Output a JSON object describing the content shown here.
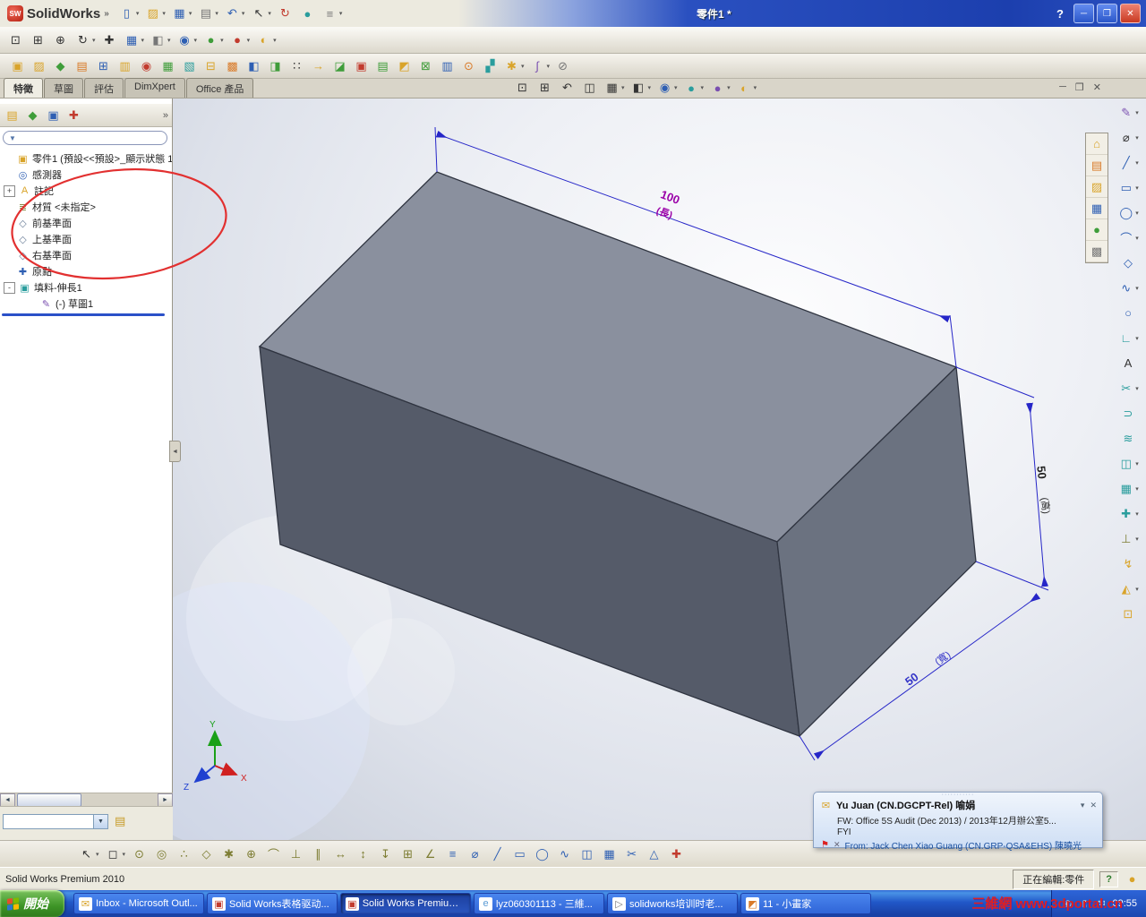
{
  "app": {
    "logo_text": "SolidWorks",
    "logo_chevron": "»",
    "title": "零件1 *",
    "help": "?",
    "min": "─",
    "restore": "❒",
    "close": "✕"
  },
  "toolbar_main": {
    "items": [
      {
        "name": "new-document-button",
        "glyph": "▯",
        "cls": "c-blue",
        "caret": true
      },
      {
        "name": "open-document-button",
        "glyph": "▨",
        "cls": "c-gold",
        "caret": true
      },
      {
        "name": "save-button",
        "glyph": "▦",
        "cls": "c-blue",
        "caret": true
      },
      {
        "name": "print-button",
        "glyph": "▤",
        "cls": "c-gray",
        "caret": true
      },
      {
        "name": "undo-button",
        "glyph": "↶",
        "cls": "c-blue",
        "caret": true
      },
      {
        "name": "select-button",
        "glyph": "↖",
        "cls": "c-dark",
        "caret": true
      },
      {
        "name": "rebuild-button",
        "glyph": "↻",
        "cls": "c-red"
      },
      {
        "name": "edit-color-button",
        "glyph": "●",
        "cls": "c-teal"
      },
      {
        "name": "options-button",
        "glyph": "≡",
        "cls": "c-gray",
        "caret": true
      }
    ]
  },
  "toolbar_view": {
    "items": [
      {
        "name": "zoom-to-fit-button",
        "glyph": "⊡",
        "cls": "c-dark"
      },
      {
        "name": "zoom-to-area-button",
        "glyph": "⊞",
        "cls": "c-dark"
      },
      {
        "name": "zoom-in-out-button",
        "glyph": "⊕",
        "cls": "c-dark"
      },
      {
        "name": "rotate-view-button",
        "glyph": "↻",
        "cls": "c-dark",
        "caret": true
      },
      {
        "name": "pan-view-button",
        "glyph": "✚",
        "cls": "c-dark"
      },
      {
        "name": "view-orientation-button",
        "glyph": "▦",
        "cls": "c-blue",
        "caret": true
      },
      {
        "name": "display-style-button",
        "glyph": "◧",
        "cls": "c-gray",
        "caret": true
      },
      {
        "name": "hide-show-items-button",
        "glyph": "◉",
        "cls": "c-blue",
        "caret": true
      },
      {
        "name": "edit-appearance-button",
        "glyph": "●",
        "cls": "c-green",
        "caret": true
      },
      {
        "name": "apply-scene-button",
        "glyph": "●",
        "cls": "c-red",
        "caret": true
      },
      {
        "name": "view-settings-button",
        "glyph": "◐",
        "cls": "c-gold",
        "caret": true
      }
    ]
  },
  "toolbar_custom": {
    "items": [
      {
        "name": "macro-tool-1",
        "glyph": "▣",
        "cls": "c-gold"
      },
      {
        "name": "macro-tool-2",
        "glyph": "▨",
        "cls": "c-gold"
      },
      {
        "name": "macro-tool-3",
        "glyph": "◆",
        "cls": "c-green"
      },
      {
        "name": "macro-tool-4",
        "glyph": "▤",
        "cls": "c-orange"
      },
      {
        "name": "macro-tool-5",
        "glyph": "⊞",
        "cls": "c-blue"
      },
      {
        "name": "macro-tool-6",
        "glyph": "▥",
        "cls": "c-gold"
      },
      {
        "name": "macro-tool-7",
        "glyph": "◉",
        "cls": "c-red"
      },
      {
        "name": "macro-tool-8",
        "glyph": "▦",
        "cls": "c-green"
      },
      {
        "name": "macro-tool-9",
        "glyph": "▧",
        "cls": "c-teal"
      },
      {
        "name": "macro-tool-10",
        "glyph": "⊟",
        "cls": "c-gold"
      },
      {
        "name": "macro-tool-11",
        "glyph": "▩",
        "cls": "c-orange"
      },
      {
        "name": "macro-tool-12",
        "glyph": "◧",
        "cls": "c-blue"
      },
      {
        "name": "macro-tool-13",
        "glyph": "◨",
        "cls": "c-green"
      },
      {
        "name": "macro-tool-14",
        "glyph": "∷",
        "cls": "c-dark"
      },
      {
        "name": "macro-tool-15",
        "glyph": "→",
        "cls": "c-gold"
      },
      {
        "name": "macro-tool-16",
        "glyph": "◪",
        "cls": "c-green"
      },
      {
        "name": "macro-tool-17",
        "glyph": "▣",
        "cls": "c-red"
      },
      {
        "name": "macro-tool-18",
        "glyph": "▤",
        "cls": "c-green"
      },
      {
        "name": "macro-tool-19",
        "glyph": "◩",
        "cls": "c-gold"
      },
      {
        "name": "macro-tool-20",
        "glyph": "⊠",
        "cls": "c-green"
      },
      {
        "name": "macro-tool-21",
        "glyph": "▥",
        "cls": "c-blue"
      },
      {
        "name": "macro-tool-22",
        "glyph": "⊙",
        "cls": "c-orange"
      },
      {
        "name": "macro-tool-23",
        "glyph": "▞",
        "cls": "c-teal"
      },
      {
        "name": "spellcheck-tool",
        "glyph": "✱",
        "cls": "c-gold",
        "caret": true
      },
      {
        "name": "curvature-tool",
        "glyph": "∫",
        "cls": "c-purple",
        "caret": true
      },
      {
        "name": "detach-tool",
        "glyph": "⊘",
        "cls": "c-gray"
      }
    ]
  },
  "command_tabs": [
    {
      "name": "tab-features",
      "label": "特徵",
      "cls": "active"
    },
    {
      "name": "tab-sketch",
      "label": "草圖"
    },
    {
      "name": "tab-evaluate",
      "label": "評估"
    },
    {
      "name": "tab-dimxpert",
      "label": "DimXpert"
    },
    {
      "name": "tab-office-products",
      "label": "Office 產品"
    }
  ],
  "heads_up": {
    "items": [
      {
        "name": "hud-zoom-to-fit",
        "glyph": "⊡",
        "cls": "c-dark"
      },
      {
        "name": "hud-zoom-to-area",
        "glyph": "⊞",
        "cls": "c-dark"
      },
      {
        "name": "hud-previous-view",
        "glyph": "↶",
        "cls": "c-dark"
      },
      {
        "name": "hud-section-view",
        "glyph": "◫",
        "cls": "c-dark"
      },
      {
        "name": "hud-view-orientation",
        "glyph": "▦",
        "cls": "c-dark",
        "caret": true
      },
      {
        "name": "hud-display-style",
        "glyph": "◧",
        "cls": "c-dark",
        "caret": true
      },
      {
        "name": "hud-hide-show-items",
        "glyph": "◉",
        "cls": "c-blue",
        "caret": true
      },
      {
        "name": "hud-edit-appearance",
        "glyph": "●",
        "cls": "c-teal",
        "caret": true
      },
      {
        "name": "hud-apply-scene",
        "glyph": "●",
        "cls": "c-purple",
        "caret": true
      },
      {
        "name": "hud-view-settings",
        "glyph": "◐",
        "cls": "c-gold",
        "caret": true
      }
    ]
  },
  "doc_controls": [
    {
      "name": "document-minimize-button",
      "glyph": "─"
    },
    {
      "name": "document-restore-button",
      "glyph": "❒"
    },
    {
      "name": "document-close-button",
      "glyph": "✕"
    }
  ],
  "panel_tabs": [
    {
      "name": "featuremanager-tab",
      "glyph": "▤",
      "cls": "c-gold"
    },
    {
      "name": "propertymanager-tab",
      "glyph": "◆",
      "cls": "c-green"
    },
    {
      "name": "configurationmanager-tab",
      "glyph": "▣",
      "cls": "c-blue"
    },
    {
      "name": "dimxpertmanager-tab",
      "glyph": "✚",
      "cls": "c-red"
    }
  ],
  "panel": {
    "overflow_glyph": "»",
    "filter_value": "",
    "funnel_glyph": "▼",
    "splitter_glyph": "◄"
  },
  "tree": {
    "root": {
      "name": "tree-item-part1",
      "label": "零件1 (預設<<預設>_顯示狀態 1",
      "glyph": "▣",
      "cls": "c-gold"
    },
    "items": [
      {
        "name": "tree-item-sensors",
        "label": "感測器",
        "glyph": "◎",
        "cls": "c-blue",
        "expand": ""
      },
      {
        "name": "tree-item-annotations",
        "label": "註記",
        "glyph": "A",
        "cls": "c-gold",
        "expand": "+"
      },
      {
        "name": "tree-item-material",
        "label": "材質 <未指定>",
        "glyph": "≣",
        "cls": "c-olive",
        "expand": ""
      },
      {
        "name": "tree-item-front-plane",
        "label": "前基準面",
        "glyph": "◇",
        "cls": "c-slate",
        "expand": ""
      },
      {
        "name": "tree-item-top-plane",
        "label": "上基準面",
        "glyph": "◇",
        "cls": "c-slate",
        "expand": ""
      },
      {
        "name": "tree-item-right-plane",
        "label": "右基準面",
        "glyph": "◇",
        "cls": "c-slate",
        "expand": ""
      },
      {
        "name": "tree-item-origin",
        "label": "原點",
        "glyph": "✚",
        "cls": "c-blue",
        "expand": ""
      },
      {
        "name": "tree-item-boss-extrude1",
        "label": "填料-伸長1",
        "glyph": "▣",
        "cls": "c-teal",
        "expand": "-"
      },
      {
        "name": "tree-item-sketch1",
        "label": "(-) 草圖1",
        "glyph": "✎",
        "cls": "c-purple",
        "expand": "",
        "indent": "child"
      }
    ]
  },
  "viewport": {
    "dim_length": "100",
    "dim_length_unit": "(長)",
    "dim_height": "50",
    "dim_height_unit": "(高)",
    "dim_width": "50",
    "dim_width_unit": "(寬)",
    "triad": {
      "x": "X",
      "y": "Y",
      "z": "Z"
    }
  },
  "right_toolbar": {
    "items": [
      {
        "name": "sketch-tool",
        "glyph": "✎",
        "cls": "c-purple",
        "caret": true
      },
      {
        "name": "smart-dimension-tool",
        "glyph": "⌀",
        "cls": "c-dark",
        "caret": true
      },
      {
        "name": "line-tool",
        "glyph": "╱",
        "cls": "c-blue",
        "caret": true
      },
      {
        "name": "rectangle-tool",
        "glyph": "▭",
        "cls": "c-blue",
        "caret": true
      },
      {
        "name": "circle-tool",
        "glyph": "◯",
        "cls": "c-blue",
        "caret": true
      },
      {
        "name": "arc-tool",
        "glyph": "⌒",
        "cls": "c-blue",
        "caret": true
      },
      {
        "name": "polygon-tool",
        "glyph": "◇",
        "cls": "c-blue"
      },
      {
        "name": "spline-tool",
        "glyph": "∿",
        "cls": "c-blue",
        "caret": true
      },
      {
        "name": "ellipse-tool",
        "glyph": "○",
        "cls": "c-blue"
      },
      {
        "name": "fillet-tool",
        "glyph": "∟",
        "cls": "c-teal",
        "caret": true
      },
      {
        "name": "text-tool",
        "glyph": "A",
        "cls": "c-dark"
      },
      {
        "name": "trim-entities-tool",
        "glyph": "✂",
        "cls": "c-teal",
        "caret": true
      },
      {
        "name": "convert-entities-tool",
        "glyph": "⊃",
        "cls": "c-teal"
      },
      {
        "name": "offset-entities-tool",
        "glyph": "≋",
        "cls": "c-teal"
      },
      {
        "name": "mirror-entities-tool",
        "glyph": "◫",
        "cls": "c-teal",
        "caret": true
      },
      {
        "name": "linear-pattern-tool",
        "glyph": "▦",
        "cls": "c-teal",
        "caret": true
      },
      {
        "name": "move-entities-tool",
        "glyph": "✚",
        "cls": "c-teal",
        "caret": true
      },
      {
        "name": "display-relations-tool",
        "glyph": "⊥",
        "cls": "c-olive",
        "caret": true
      },
      {
        "name": "repair-sketch-tool",
        "glyph": "↯",
        "cls": "c-gold"
      },
      {
        "name": "quick-snaps-tool",
        "glyph": "◭",
        "cls": "c-gold",
        "caret": true
      },
      {
        "name": "rapid-sketch-tool",
        "glyph": "⊡",
        "cls": "c-gold"
      }
    ]
  },
  "taskpane": {
    "items": [
      {
        "name": "solidworks-resources-tab",
        "glyph": "⌂",
        "cls": "c-gold"
      },
      {
        "name": "design-library-tab",
        "glyph": "▤",
        "cls": "c-orange"
      },
      {
        "name": "file-explorer-tab",
        "glyph": "▨",
        "cls": "c-gold"
      },
      {
        "name": "view-palette-tab",
        "glyph": "▦",
        "cls": "c-blue"
      },
      {
        "name": "appearances-scenes-tab",
        "glyph": "●",
        "cls": "c-green"
      },
      {
        "name": "custom-properties-tab",
        "glyph": "▩",
        "cls": "c-gray"
      }
    ]
  },
  "snap_toolbar": {
    "items": [
      {
        "name": "selection-arrow-tool",
        "glyph": "↖",
        "cls": "c-dark",
        "caret": true
      },
      {
        "name": "selection-filter-toggle",
        "glyph": "◻",
        "cls": "c-dark",
        "caret": true
      },
      {
        "name": "point-snap",
        "glyph": "⊙",
        "cls": "c-olive"
      },
      {
        "name": "center-snap",
        "glyph": "◎",
        "cls": "c-olive"
      },
      {
        "name": "midpoint-snap",
        "glyph": "∴",
        "cls": "c-olive"
      },
      {
        "name": "quadrant-snap",
        "glyph": "◇",
        "cls": "c-olive"
      },
      {
        "name": "intersection-snap",
        "glyph": "✱",
        "cls": "c-olive"
      },
      {
        "name": "nearest-snap",
        "glyph": "⊕",
        "cls": "c-olive"
      },
      {
        "name": "tangent-snap",
        "glyph": "⌒",
        "cls": "c-olive"
      },
      {
        "name": "perpendicular-snap",
        "glyph": "⊥",
        "cls": "c-olive"
      },
      {
        "name": "parallel-snap",
        "glyph": "∥",
        "cls": "c-olive"
      },
      {
        "name": "horizontal-snap",
        "glyph": "↔",
        "cls": "c-olive"
      },
      {
        "name": "vertical-snap",
        "glyph": "↕",
        "cls": "c-olive"
      },
      {
        "name": "length-snap",
        "glyph": "↧",
        "cls": "c-olive"
      },
      {
        "name": "grid-snap",
        "glyph": "⊞",
        "cls": "c-olive"
      },
      {
        "name": "angle-snap",
        "glyph": "∠",
        "cls": "c-olive"
      },
      {
        "name": "sketch-relations-toggle",
        "glyph": "≡",
        "cls": "c-blue"
      },
      {
        "name": "dimension-snap",
        "glyph": "⌀",
        "cls": "c-blue"
      },
      {
        "name": "line-snap",
        "glyph": "╱",
        "cls": "c-blue"
      },
      {
        "name": "rectangle-snap",
        "glyph": "▭",
        "cls": "c-blue"
      },
      {
        "name": "circle-snap",
        "glyph": "◯",
        "cls": "c-blue"
      },
      {
        "name": "spline-snap",
        "glyph": "∿",
        "cls": "c-blue"
      },
      {
        "name": "mirror-snap",
        "glyph": "◫",
        "cls": "c-blue"
      },
      {
        "name": "pattern-snap",
        "glyph": "▦",
        "cls": "c-blue"
      },
      {
        "name": "trim-snap",
        "glyph": "✂",
        "cls": "c-blue"
      },
      {
        "name": "measure-snap",
        "glyph": "△",
        "cls": "c-blue"
      },
      {
        "name": "origin-toggle",
        "glyph": "✚",
        "cls": "c-red"
      }
    ]
  },
  "status": {
    "left": "Solid Works Premium 2010",
    "editing": "正在編輯:零件",
    "help": "?",
    "ball": "●"
  },
  "email_alert": {
    "sender": "Yu Juan (CN.DGCPT-Rel) 喻娟",
    "subject": "FW: Office 5S Audit (Dec  2013) / 2013年12月辦公室5...",
    "body": "FYI",
    "from": "From: Jack Chen Xiao Guang (CN.GRP-QSA&EHS) 陳曉光"
  },
  "taskbar": {
    "start": "開始",
    "buttons": [
      {
        "name": "task-outlook",
        "label": "Inbox - Microsoft Outl...",
        "glyph": "✉",
        "cls": "c-gold"
      },
      {
        "name": "task-solidworks-table",
        "label": "Solid Works表格驱动...",
        "glyph": "▣",
        "cls": "c-red"
      },
      {
        "name": "task-solidworks-premium",
        "label": "Solid Works Premium ...",
        "glyph": "▣",
        "cls": "c-red",
        "active": "active"
      },
      {
        "name": "task-browser",
        "label": "lyz060301113 - 三維...",
        "glyph": "e",
        "cls": "c-lblue"
      },
      {
        "name": "task-training-video",
        "label": "solidworks培训时老...",
        "glyph": "▷",
        "cls": "c-gray"
      },
      {
        "name": "task-paint",
        "label": "11 - 小畫家",
        "glyph": "◩",
        "cls": "c-orange"
      }
    ],
    "clock": "09:55",
    "watermark_a": "三維網",
    "watermark_b": "www.3dportal.cn"
  },
  "colors": {
    "dim_line": "#2626c8",
    "dim_length_text": "#9a00a8",
    "dim_height_text": "#222222",
    "dim_width_text": "#3434c8",
    "annotation": "#e23030"
  }
}
